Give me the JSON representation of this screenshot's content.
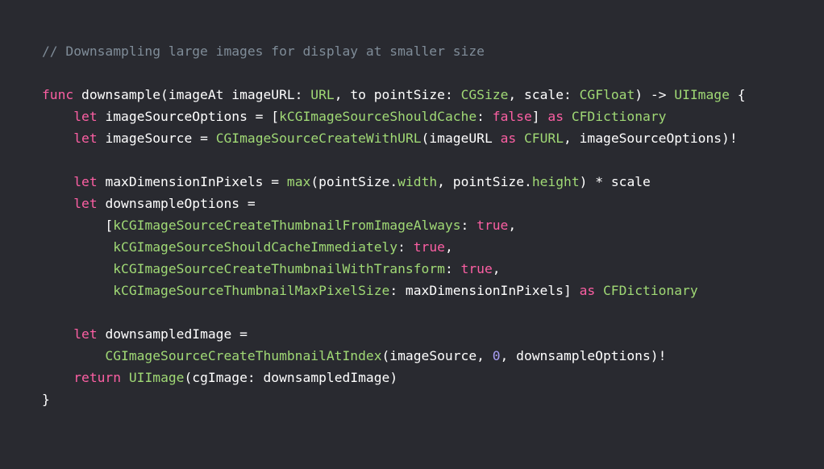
{
  "editor": {
    "theme_colors": {
      "background": "#292a30",
      "plain": "#ffffff",
      "keyword": "#fc5fa3",
      "type": "#a0d975",
      "function": "#a0d975",
      "number": "#a79df2",
      "comment": "#7f8c98"
    },
    "lines": [
      [
        {
          "k": "comment",
          "t": "// Downsampling large images for display at smaller size"
        }
      ],
      [],
      [
        {
          "k": "keyword",
          "t": "func"
        },
        {
          "k": "plain",
          "t": " downsample(imageAt imageURL: "
        },
        {
          "k": "type",
          "t": "URL"
        },
        {
          "k": "plain",
          "t": ", to pointSize: "
        },
        {
          "k": "type",
          "t": "CGSize"
        },
        {
          "k": "plain",
          "t": ", scale: "
        },
        {
          "k": "type",
          "t": "CGFloat"
        },
        {
          "k": "plain",
          "t": ") -> "
        },
        {
          "k": "type",
          "t": "UIImage"
        },
        {
          "k": "plain",
          "t": " {"
        }
      ],
      [
        {
          "k": "plain",
          "t": "    "
        },
        {
          "k": "keyword",
          "t": "let"
        },
        {
          "k": "plain",
          "t": " imageSourceOptions = ["
        },
        {
          "k": "func",
          "t": "kCGImageSourceShouldCache"
        },
        {
          "k": "plain",
          "t": ": "
        },
        {
          "k": "keyword",
          "t": "false"
        },
        {
          "k": "plain",
          "t": "] "
        },
        {
          "k": "keyword",
          "t": "as"
        },
        {
          "k": "plain",
          "t": " "
        },
        {
          "k": "type",
          "t": "CFDictionary"
        }
      ],
      [
        {
          "k": "plain",
          "t": "    "
        },
        {
          "k": "keyword",
          "t": "let"
        },
        {
          "k": "plain",
          "t": " imageSource = "
        },
        {
          "k": "func",
          "t": "CGImageSourceCreateWithURL"
        },
        {
          "k": "plain",
          "t": "(imageURL "
        },
        {
          "k": "keyword",
          "t": "as"
        },
        {
          "k": "plain",
          "t": " "
        },
        {
          "k": "type",
          "t": "CFURL"
        },
        {
          "k": "plain",
          "t": ", imageSourceOptions)!"
        }
      ],
      [],
      [
        {
          "k": "plain",
          "t": "    "
        },
        {
          "k": "keyword",
          "t": "let"
        },
        {
          "k": "plain",
          "t": " maxDimensionInPixels = "
        },
        {
          "k": "func",
          "t": "max"
        },
        {
          "k": "plain",
          "t": "(pointSize."
        },
        {
          "k": "prop",
          "t": "width"
        },
        {
          "k": "plain",
          "t": ", pointSize."
        },
        {
          "k": "prop",
          "t": "height"
        },
        {
          "k": "plain",
          "t": ") * scale"
        }
      ],
      [
        {
          "k": "plain",
          "t": "    "
        },
        {
          "k": "keyword",
          "t": "let"
        },
        {
          "k": "plain",
          "t": " downsampleOptions ="
        }
      ],
      [
        {
          "k": "plain",
          "t": "        ["
        },
        {
          "k": "func",
          "t": "kCGImageSourceCreateThumbnailFromImageAlways"
        },
        {
          "k": "plain",
          "t": ": "
        },
        {
          "k": "keyword",
          "t": "true"
        },
        {
          "k": "plain",
          "t": ","
        }
      ],
      [
        {
          "k": "plain",
          "t": "         "
        },
        {
          "k": "func",
          "t": "kCGImageSourceShouldCacheImmediately"
        },
        {
          "k": "plain",
          "t": ": "
        },
        {
          "k": "keyword",
          "t": "true"
        },
        {
          "k": "plain",
          "t": ","
        }
      ],
      [
        {
          "k": "plain",
          "t": "         "
        },
        {
          "k": "func",
          "t": "kCGImageSourceCreateThumbnailWithTransform"
        },
        {
          "k": "plain",
          "t": ": "
        },
        {
          "k": "keyword",
          "t": "true"
        },
        {
          "k": "plain",
          "t": ","
        }
      ],
      [
        {
          "k": "plain",
          "t": "         "
        },
        {
          "k": "func",
          "t": "kCGImageSourceThumbnailMaxPixelSize"
        },
        {
          "k": "plain",
          "t": ": maxDimensionInPixels] "
        },
        {
          "k": "keyword",
          "t": "as"
        },
        {
          "k": "plain",
          "t": " "
        },
        {
          "k": "type",
          "t": "CFDictionary"
        }
      ],
      [],
      [
        {
          "k": "plain",
          "t": "    "
        },
        {
          "k": "keyword",
          "t": "let"
        },
        {
          "k": "plain",
          "t": " downsampledImage ="
        }
      ],
      [
        {
          "k": "plain",
          "t": "        "
        },
        {
          "k": "func",
          "t": "CGImageSourceCreateThumbnailAtIndex"
        },
        {
          "k": "plain",
          "t": "(imageSource, "
        },
        {
          "k": "number",
          "t": "0"
        },
        {
          "k": "plain",
          "t": ", downsampleOptions)!"
        }
      ],
      [
        {
          "k": "plain",
          "t": "    "
        },
        {
          "k": "keyword",
          "t": "return"
        },
        {
          "k": "plain",
          "t": " "
        },
        {
          "k": "type",
          "t": "UIImage"
        },
        {
          "k": "plain",
          "t": "(cgImage: downsampledImage)"
        }
      ],
      [
        {
          "k": "plain",
          "t": "}"
        }
      ]
    ]
  }
}
